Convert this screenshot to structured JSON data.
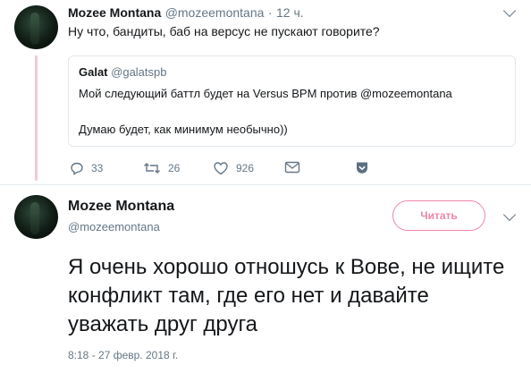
{
  "reply_tweet": {
    "author_name": "Mozee Montana",
    "author_handle": "@mozeemontana",
    "time_ago": "12 ч.",
    "text": "Ну что, бандиты, баб на версус не пускают говорите?",
    "quoted": {
      "author_name": "Galat",
      "author_handle": "@galatspb",
      "line1": "Мой следующий баттл будет на Versus BPM против @mozeemontana",
      "line2": "Думаю будет, как минимум необычно))"
    },
    "actions": {
      "replies": "33",
      "retweets": "26",
      "likes": "926"
    }
  },
  "main_tweet": {
    "author_name": "Mozee Montana",
    "author_handle": "@mozeemontana",
    "follow_label": "Читать",
    "text": "Я очень хорошо отношусь к Вове, не ищите конфликт там, где его нет и давайте уважать друг друга",
    "timestamp": "8:18 - 27 февр. 2018 г."
  },
  "colors": {
    "thread_line": "#f5c8d1",
    "follow_button": "#e0245e",
    "muted_text": "#657786",
    "verified_accent": "#1da1f2"
  },
  "icons": [
    "reply-icon",
    "retweet-icon",
    "like-icon",
    "direct-message-icon",
    "bookmark-icon",
    "chevron-down-icon"
  ]
}
